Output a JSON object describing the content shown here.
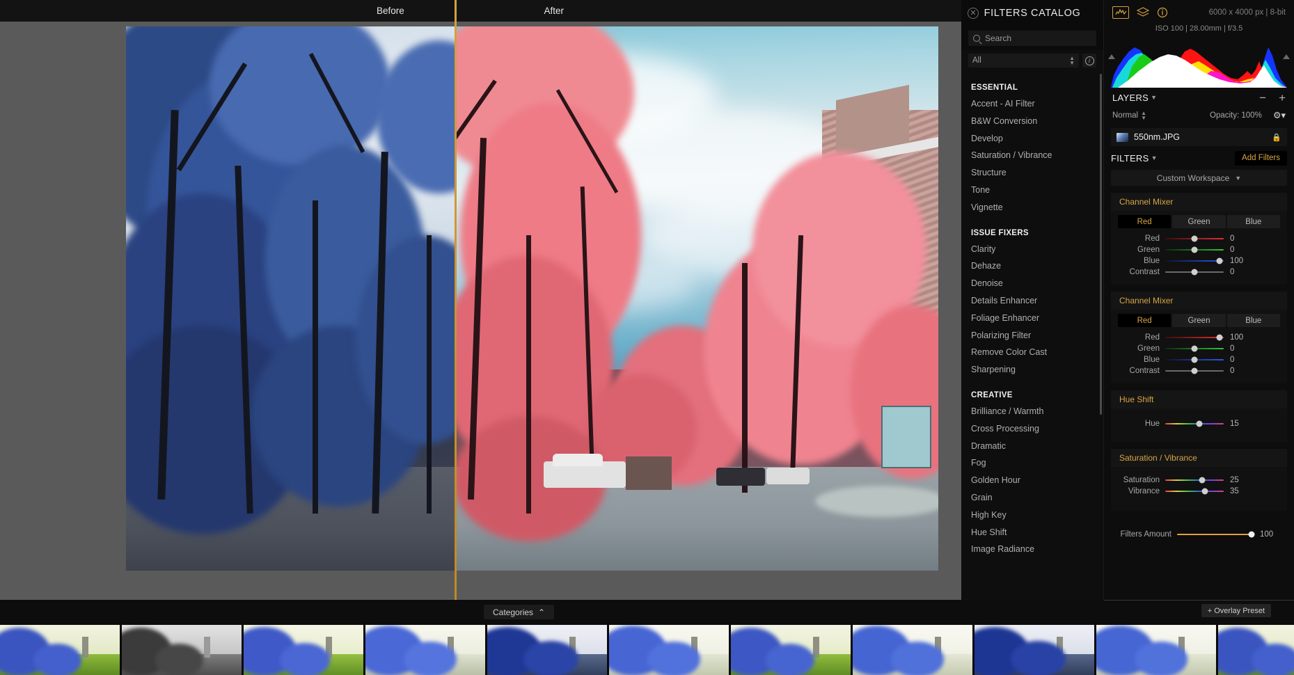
{
  "canvas": {
    "before_label": "Before",
    "after_label": "After"
  },
  "catalog": {
    "title": "FILTERS CATALOG",
    "close_icon": "close-icon",
    "search_placeholder": "Search",
    "search_value": "",
    "category_filter": "All",
    "info_icon": "info-icon",
    "groups": [
      {
        "name": "ESSENTIAL",
        "items": [
          "Accent - AI Filter",
          "B&W Conversion",
          "Develop",
          "Saturation / Vibrance",
          "Structure",
          "Tone",
          "Vignette"
        ]
      },
      {
        "name": "ISSUE FIXERS",
        "items": [
          "Clarity",
          "Dehaze",
          "Denoise",
          "Details Enhancer",
          "Foliage Enhancer",
          "Polarizing Filter",
          "Remove Color Cast",
          "Sharpening"
        ]
      },
      {
        "name": "CREATIVE",
        "items": [
          "Brilliance / Warmth",
          "Cross Processing",
          "Dramatic",
          "Fog",
          "Golden Hour",
          "Grain",
          "High Key",
          "Hue Shift",
          "Image Radiance"
        ]
      }
    ]
  },
  "right_panel": {
    "toolbar_icons": [
      "histogram-icon",
      "layers-stack-icon",
      "info-icon"
    ],
    "image_dimensions": "6000 x 4000 px  |  8-bit",
    "exif": "ISO 100  |  28.00mm  |  f/3.5",
    "layers": {
      "title": "LAYERS",
      "remove_label": "−",
      "add_label": "+",
      "blend_mode": "Normal",
      "opacity_label": "Opacity: 100%",
      "gear_icon": "gear-icon",
      "layer_name": "550nm.JPG",
      "lock_icon": "lock-icon"
    },
    "filters": {
      "title": "FILTERS",
      "add_button": "Add Filters",
      "workspace": "Custom Workspace",
      "cards": [
        {
          "name": "Channel Mixer",
          "tabs": [
            "Red",
            "Green",
            "Blue"
          ],
          "active_tab": "Red",
          "sliders": [
            {
              "label": "Red",
              "value": 0,
              "pos": 50,
              "track": "t-red"
            },
            {
              "label": "Green",
              "value": 0,
              "pos": 50,
              "track": "t-green"
            },
            {
              "label": "Blue",
              "value": 100,
              "pos": 93,
              "track": "t-blue"
            },
            {
              "label": "Contrast",
              "value": 0,
              "pos": 50,
              "track": "t-gray"
            }
          ]
        },
        {
          "name": "Channel Mixer",
          "tabs": [
            "Red",
            "Green",
            "Blue"
          ],
          "active_tab": "Red",
          "sliders": [
            {
              "label": "Red",
              "value": 100,
              "pos": 93,
              "track": "t-red"
            },
            {
              "label": "Green",
              "value": 0,
              "pos": 50,
              "track": "t-green"
            },
            {
              "label": "Blue",
              "value": 0,
              "pos": 50,
              "track": "t-blue"
            },
            {
              "label": "Contrast",
              "value": 0,
              "pos": 50,
              "track": "t-gray"
            }
          ]
        },
        {
          "name": "Hue Shift",
          "tabs": [],
          "active_tab": "",
          "sliders": [
            {
              "label": "Hue",
              "value": 15,
              "pos": 58,
              "track": "t-hue"
            }
          ]
        },
        {
          "name": "Saturation / Vibrance",
          "tabs": [],
          "active_tab": "",
          "sliders": [
            {
              "label": "Saturation",
              "value": 25,
              "pos": 63,
              "track": "t-hue"
            },
            {
              "label": "Vibrance",
              "value": 35,
              "pos": 68,
              "track": "t-hue"
            }
          ]
        }
      ],
      "amount": {
        "label": "Filters Amount",
        "value": 100,
        "pos": 97
      }
    }
  },
  "bottom": {
    "categories_label": "Categories",
    "categories_chevron": "chevron-up-icon",
    "overlay_preset_label": "+ Overlay Preset",
    "thumbnails": [
      {
        "style": "blue-green"
      },
      {
        "style": "mono"
      },
      {
        "style": "blue-green"
      },
      {
        "style": "blue-cream"
      },
      {
        "style": "blue-dark"
      },
      {
        "style": "blue-cream"
      },
      {
        "style": "blue-green"
      },
      {
        "style": "blue-cream"
      },
      {
        "style": "blue-dark"
      },
      {
        "style": "blue-cream"
      },
      {
        "style": "blue-green"
      }
    ]
  },
  "colors": {
    "accent": "#d9a544",
    "panel_bg": "#0d0d0d",
    "canvas_bg": "#5a5a5a"
  }
}
